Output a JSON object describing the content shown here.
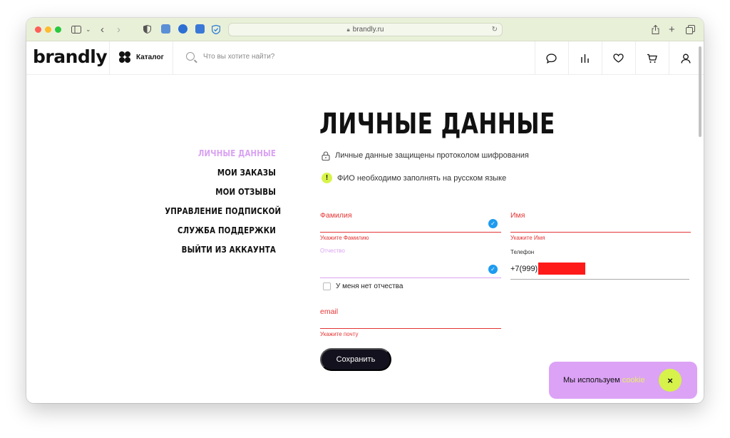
{
  "browser": {
    "url": "brandly.ru"
  },
  "header": {
    "logo": "brandly",
    "catalog_label": "Каталог",
    "search_placeholder": "Что вы хотите найти?"
  },
  "menu": {
    "items": [
      {
        "label": "ЛИЧНЫЕ ДАННЫЕ",
        "active": true
      },
      {
        "label": "МОИ ЗАКАЗЫ",
        "active": false
      },
      {
        "label": "МОИ ОТЗЫВЫ",
        "active": false
      },
      {
        "label": "УПРАВЛЕНИЕ ПОДПИСКОЙ",
        "active": false
      },
      {
        "label": "СЛУЖБА ПОДДЕРЖКИ",
        "active": false
      },
      {
        "label": "ВЫЙТИ ИЗ АККАУНТА",
        "active": false
      }
    ]
  },
  "content": {
    "title": "ЛИЧНЫЕ ДАННЫЕ",
    "security_note": "Личные данные защищены протоколом шифрования",
    "fio_note": "ФИО необходимо заполнять на русском языке",
    "warn_symbol": "!",
    "form": {
      "surname": {
        "label": "Фамилия",
        "error": "Укажите Фамилию"
      },
      "name": {
        "label": "Имя",
        "error": "Укажите Имя"
      },
      "patronymic": {
        "label": "Отчество"
      },
      "no_patronymic_label": "У меня нет отчества",
      "phone": {
        "label": "Телефон",
        "value": "+7(999)"
      },
      "email": {
        "label": "email",
        "error": "Укажите почту"
      },
      "save_label": "Сохранить",
      "check_symbol": "✓"
    }
  },
  "cookie_banner": {
    "text": "Мы используем",
    "link": "cookie",
    "close_symbol": "×"
  },
  "colors": {
    "accent_pink": "#dca2f6",
    "accent_lime": "#d6f24b",
    "error_red": "#e53535",
    "button_dark": "#12111d"
  }
}
